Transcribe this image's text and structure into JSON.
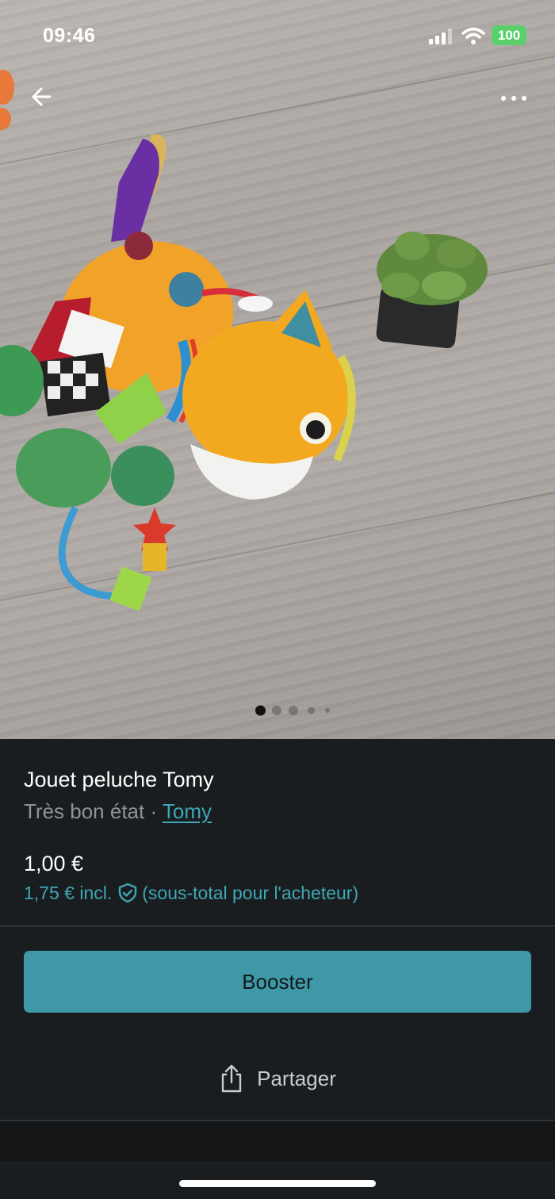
{
  "status_bar": {
    "time": "09:46",
    "battery_level": "100",
    "battery_color": "#5ad06b"
  },
  "nav": {
    "back_icon": "arrow-left-icon",
    "more_icon": "more-horizontal-icon"
  },
  "photo": {
    "description_icon": "product-photo",
    "pagination": {
      "count": 5,
      "active_index": 0
    }
  },
  "listing": {
    "title": "Jouet peluche Tomy",
    "condition": "Très bon état",
    "separator": " · ",
    "brand": "Tomy",
    "price": "1,00 €",
    "buyer_price": "1,75 € incl.",
    "buyer_note": "(sous-total pour l'acheteur)",
    "shield_icon": "buyer-protection-shield-icon"
  },
  "actions": {
    "booster_label": "Booster",
    "share_label": "Partager",
    "share_icon": "share-icon"
  },
  "colors": {
    "accent": "#3fa7b5",
    "button": "#3f98a7",
    "background": "#1a1d1f",
    "muted_text": "#8e9496"
  }
}
